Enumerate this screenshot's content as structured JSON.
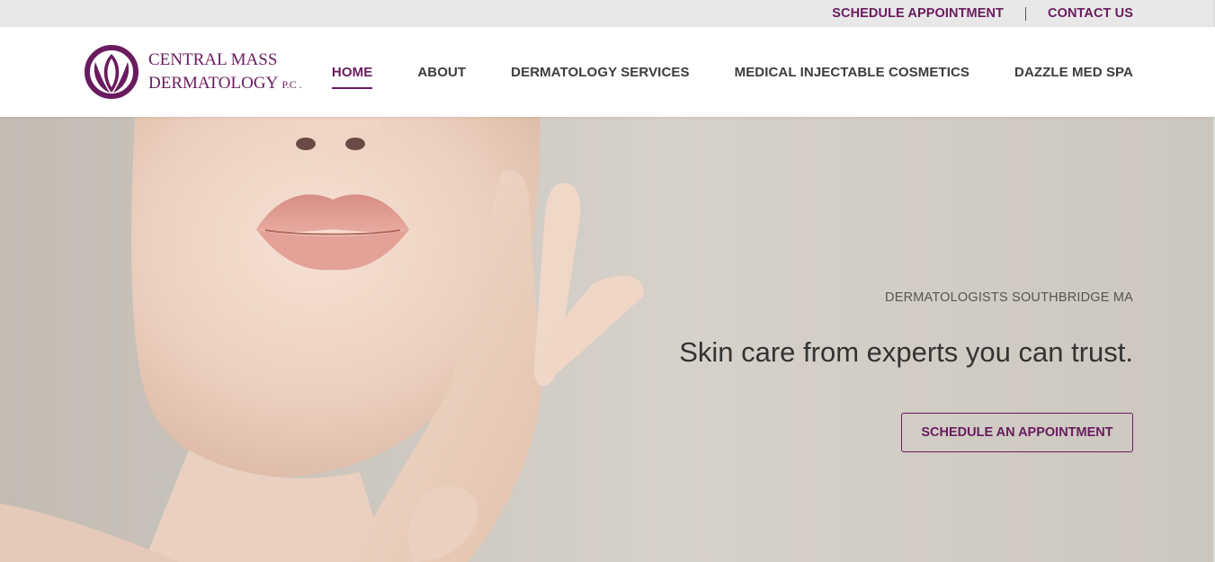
{
  "topbar": {
    "schedule_label": "SCHEDULE APPOINTMENT",
    "contact_label": "CONTACT US"
  },
  "logo": {
    "line1": "CENTRAL MASS",
    "line2": "DERMATOLOGY",
    "suffix": "P.C .",
    "icon": "lotus-icon"
  },
  "nav": {
    "items": [
      {
        "label": "HOME",
        "active": true
      },
      {
        "label": "ABOUT"
      },
      {
        "label": "DERMATOLOGY SERVICES"
      },
      {
        "label": "MEDICAL INJECTABLE COSMETICS"
      },
      {
        "label": "DAZZLE MED SPA"
      }
    ]
  },
  "hero": {
    "subtitle": "DERMATOLOGISTS SOUTHBRIDGE MA",
    "headline": "Skin care from experts you can trust.",
    "cta_label": "SCHEDULE AN APPOINTMENT",
    "image": "woman-face-photo"
  },
  "colors": {
    "brand": "#6a1b5f",
    "topbar_bg": "#e8e8e8",
    "hero_bg": "#d1ccc4"
  }
}
